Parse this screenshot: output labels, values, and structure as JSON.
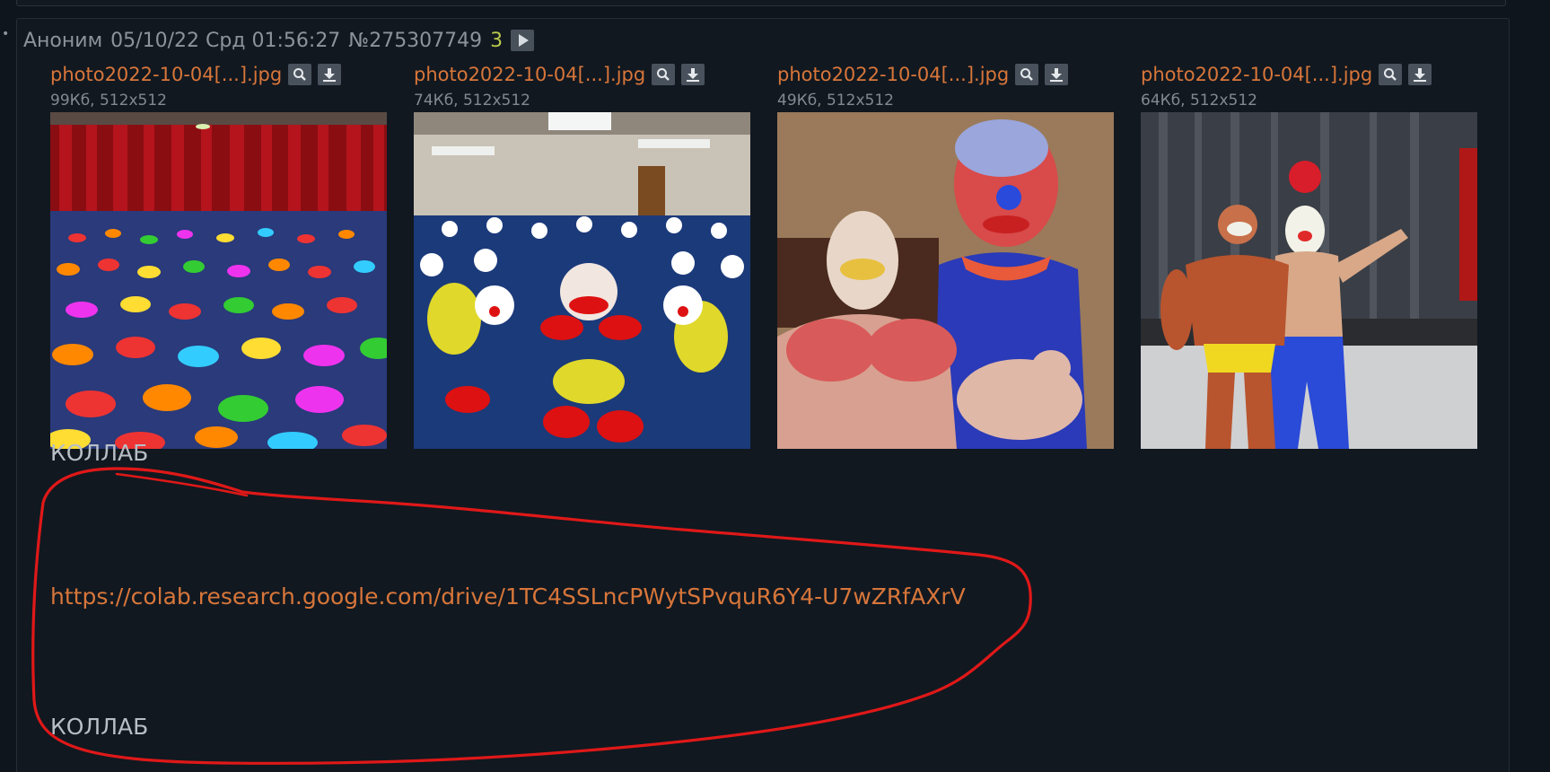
{
  "post": {
    "author": "Аноним",
    "datetime": "05/10/22 Срд 01:56:27",
    "number": "№275307749",
    "reply_count": "3"
  },
  "files": [
    {
      "name": "photo2022-10-04[...].jpg",
      "meta": "99Кб, 512x512",
      "image": "clown-crowd-auditorium"
    },
    {
      "name": "photo2022-10-04[...].jpg",
      "meta": "74Кб, 512x512",
      "image": "clowns-crawling-office"
    },
    {
      "name": "photo2022-10-04[...].jpg",
      "meta": "49Кб, 512x512",
      "image": "clown-bodybuilders-closeup"
    },
    {
      "name": "photo2022-10-04[...].jpg",
      "meta": "64Кб, 512x512",
      "image": "clown-bodybuilders-stage"
    }
  ],
  "message": {
    "line1": "КОЛЛАБ",
    "link": "https://colab.research.google.com/drive/1TC4SSLncPWytSPvquR6Y4-U7wZRfAXrV",
    "line3": "КОЛЛАБ"
  },
  "icons": {
    "search": "magnifier-icon",
    "download": "download-icon",
    "expand": "play-icon"
  },
  "colors": {
    "background": "#0f151d",
    "link": "#d8763a",
    "reply_count": "#b7c84a",
    "annotation": "#e01818"
  }
}
